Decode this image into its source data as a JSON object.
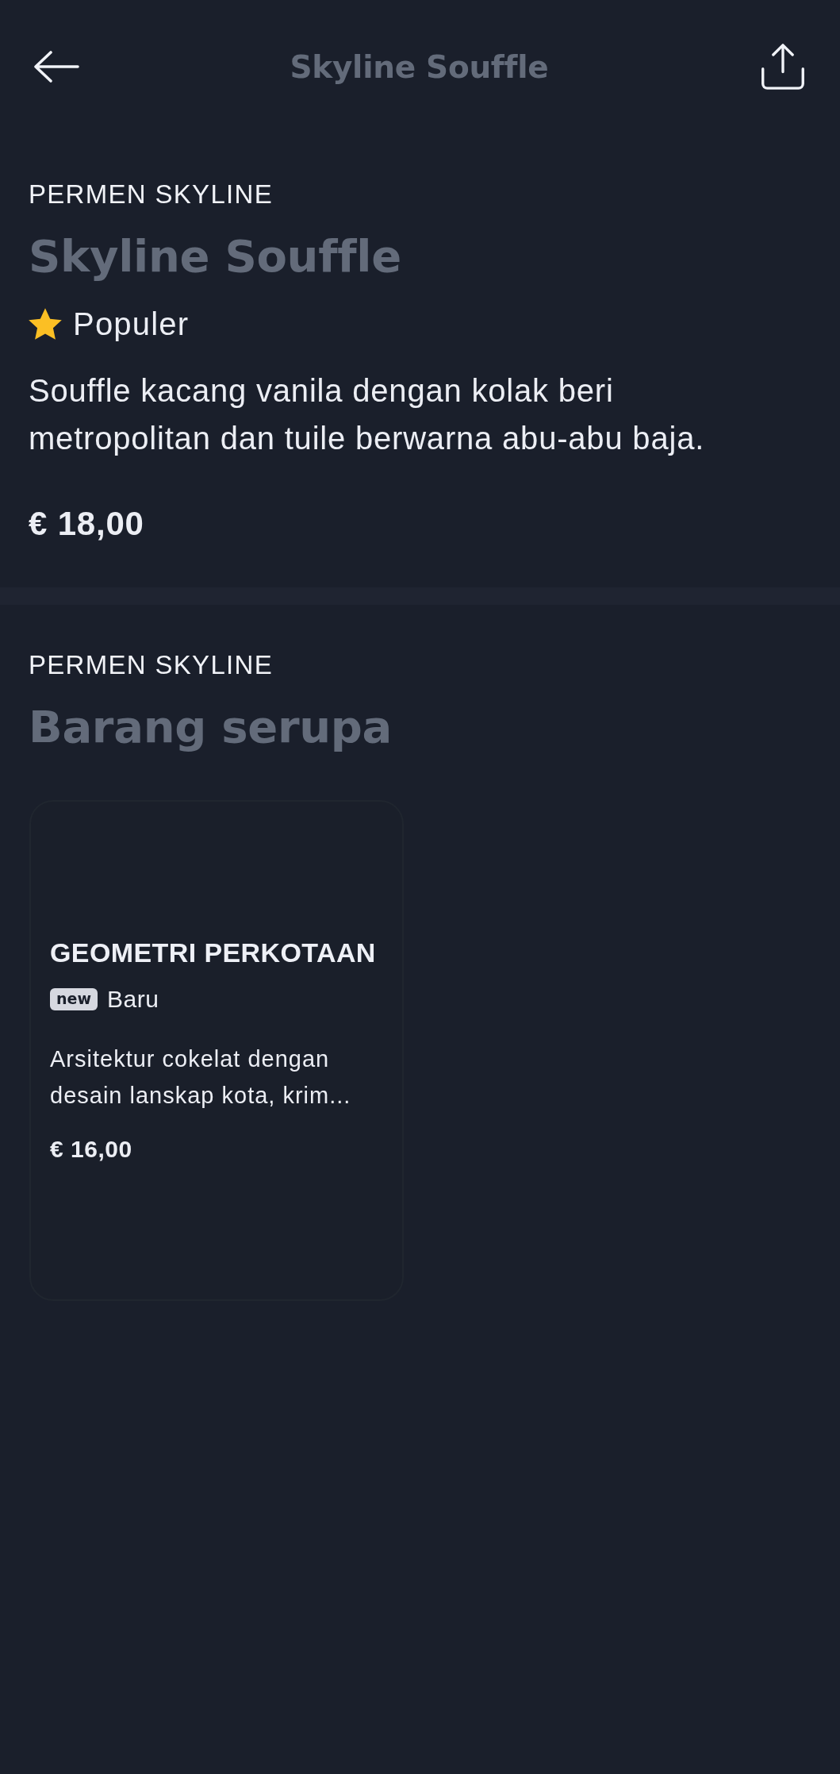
{
  "header": {
    "title": "Skyline Souffle"
  },
  "product": {
    "category": "PERMEN SKYLINE",
    "name": "Skyline Souffle",
    "tag": {
      "kind": "popular",
      "label": "Populer"
    },
    "description": "Souffle kacang vanila dengan kolak beri metropolitan dan tuile berwarna abu-abu baja.",
    "price": "€ 18,00"
  },
  "similar": {
    "category": "PERMEN SKYLINE",
    "title": "Barang serupa",
    "items": [
      {
        "name": "GEOMETRI PERKOTAAN",
        "tag": {
          "kind": "new",
          "badge": "new",
          "label": "Baru"
        },
        "description": "Arsitektur cokelat dengan desain lanskap kota, krim...",
        "price": "€ 16,00"
      }
    ]
  }
}
